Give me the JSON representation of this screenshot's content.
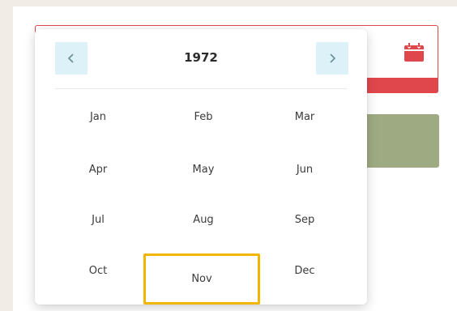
{
  "picker": {
    "year": "1972",
    "prev_icon": "chevron-left-icon",
    "next_icon": "chevron-right-icon"
  },
  "months": [
    "Jan",
    "Feb",
    "Mar",
    "Apr",
    "May",
    "Jun",
    "Jul",
    "Aug",
    "Sep",
    "Oct",
    "Nov",
    "Dec"
  ],
  "highlighted_month": "Nov",
  "date_field": {
    "icon": "calendar-icon",
    "state": "error"
  },
  "colors": {
    "accent_error": "#e0474c",
    "highlight": "#f2b600",
    "nav_button_bg": "#ddf1f8",
    "green_block": "#9eab82",
    "page_bg": "#f1ede6"
  }
}
